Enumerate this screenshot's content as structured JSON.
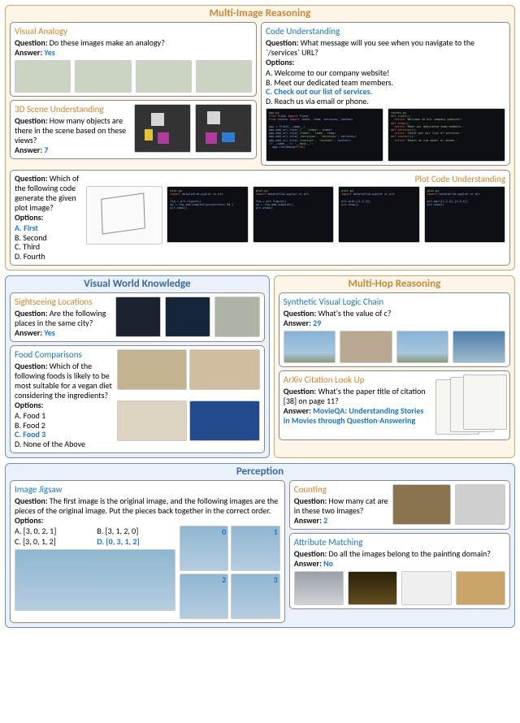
{
  "sections": {
    "mir": {
      "title": "Multi-Image Reasoning"
    },
    "vwk": {
      "title": "Visual World Knowledge"
    },
    "mhr": {
      "title": "Multi-Hop Reasoning"
    },
    "per": {
      "title": "Perception"
    }
  },
  "labels": {
    "question": "Question:",
    "answer": "Answer:",
    "options": "Options:"
  },
  "cards": {
    "visual_analogy": {
      "title": "Visual Analogy",
      "question": "Do these images make an analogy?",
      "answer": "Yes"
    },
    "code_understanding": {
      "title": "Code Understanding",
      "question": "What message will you see when you navigate to the `/services` URL?",
      "options": [
        "A. Welcome to our company website!",
        "B. Meet our dedicated team members.",
        "C. Check out our list of services.",
        "D. Reach us via email or phone."
      ],
      "correct_index": 2
    },
    "scene3d": {
      "title": "3D Scene Understanding",
      "question": "How many objects are there in the scene based on these views?",
      "answer": "7"
    },
    "plotcode": {
      "title": "Plot Code Understanding",
      "question": "Which of the following code generate the given plot image?",
      "options": [
        "A. First",
        "B. Second",
        "C. Third",
        "D. Fourth"
      ],
      "correct_index": 0
    },
    "sightseeing": {
      "title": "Sightseeing Locations",
      "question": "Are the following places in the same city?",
      "answer": "Yes"
    },
    "food": {
      "title": "Food Comparisons",
      "question": "Which of the following foods is likely to be most suitable for a vegan diet considering the ingredients?",
      "options": [
        "A. Food 1",
        "B. Food 2",
        "C. Food 3",
        "D. None of the Above"
      ],
      "correct_index": 2
    },
    "logic_chain": {
      "title": "Synthetic Visual Logic Chain",
      "question": "What's the value of c?",
      "answer": "29"
    },
    "arxiv": {
      "title": "ArXiv Citation Look Up",
      "question": "What's the paper title of citation [38] on page 11?",
      "answer": "MovieQA: Understanding Stories in Movies through Question-Answering"
    },
    "jigsaw": {
      "title": "Image Jigsaw",
      "question": "The first image is the original image, and the following images are the pieces of the original image. Put the pieces back together in the correct order.",
      "options": [
        "A. [3, 0, 2, 1]",
        "B. [3, 1, 2, 0]",
        "C. [3, 0, 1, 2]",
        "D. [0, 3, 1, 2]"
      ],
      "correct_index": 3
    },
    "counting": {
      "title": "Counting",
      "question": "How many cat are in these two images?",
      "answer": "2"
    },
    "attribute": {
      "title": "Attribute Matching",
      "question": "Do all the images belong to the painting domain?",
      "answer": "No"
    }
  }
}
